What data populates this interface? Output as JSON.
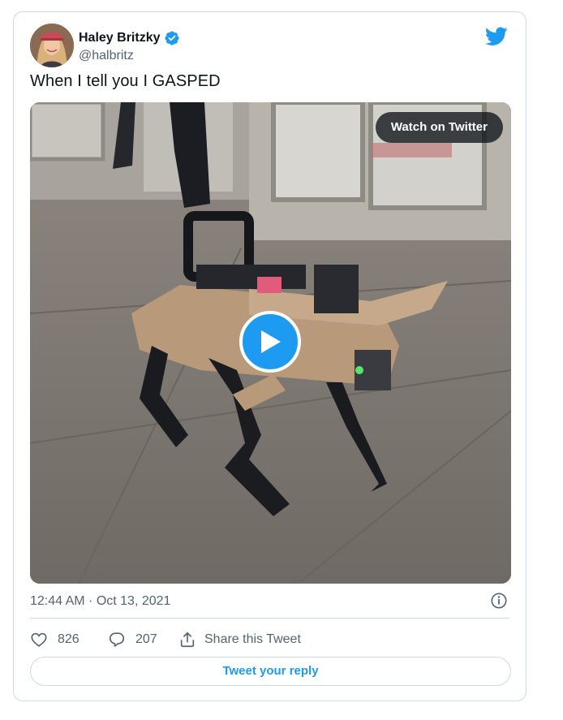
{
  "tweet": {
    "author": {
      "display_name": "Haley Britzky",
      "handle": "@halbritz",
      "verified": true,
      "avatar_icon": "avatar-photo"
    },
    "brand_icon": "twitter-bird-icon",
    "text": "When I tell you I GASPED",
    "media": {
      "type": "video",
      "watch_label": "Watch on Twitter",
      "play_icon": "play-icon"
    },
    "timestamp": "12:44 AM · Oct 13, 2021",
    "info_icon": "info-icon",
    "actions": {
      "likes": "826",
      "replies": "207",
      "share_label": "Share this Tweet"
    },
    "reply_button_label": "Tweet your reply"
  },
  "colors": {
    "accent": "#1d9bf0",
    "text_primary": "#0f1419",
    "text_secondary": "#536471",
    "border": "#cfd9de"
  }
}
